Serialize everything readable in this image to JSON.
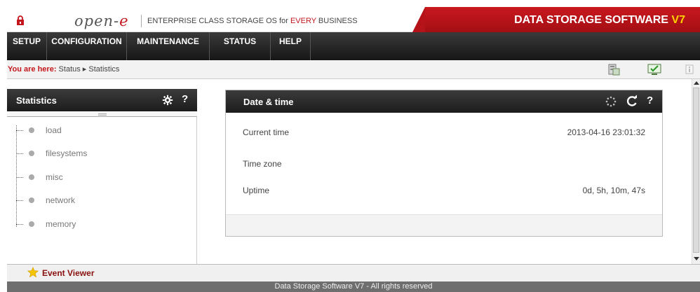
{
  "header": {
    "logo_text": "open-",
    "logo_e": "e",
    "tagline_prefix": "ENTERPRISE CLASS STORAGE OS for ",
    "tagline_highlight": "EVERY",
    "tagline_suffix": " BUSINESS",
    "product_name": "DATA STORAGE SOFTWARE ",
    "product_version": "V7",
    "lock_icon": "lock-icon",
    "brand_color": "#c4161c"
  },
  "menu": {
    "items": [
      {
        "label": "SETUP"
      },
      {
        "label": "CONFIGURATION"
      },
      {
        "label": "MAINTENANCE"
      },
      {
        "label": "STATUS"
      },
      {
        "label": "HELP"
      }
    ]
  },
  "breadcrumb": {
    "label": "You are here:",
    "path": [
      " Status ",
      " Statistics"
    ]
  },
  "toolbar": {
    "icons": [
      "server-icon",
      "monitor-check-icon",
      "info-icon"
    ]
  },
  "statistics_panel": {
    "title": "Statistics",
    "help": "?",
    "tree": [
      "load",
      "filesystems",
      "misc",
      "network",
      "memory"
    ]
  },
  "datetime_panel": {
    "title": "Date & time",
    "help": "?",
    "rows": [
      {
        "label": "Current time",
        "value": "2013-04-16 23:01:32"
      },
      {
        "label": "Time zone",
        "value": ""
      },
      {
        "label": "Uptime",
        "value": "0d, 5h, 10m, 47s"
      }
    ]
  },
  "bottom": {
    "event_viewer": "Event Viewer"
  },
  "footer": {
    "text": "Data Storage Software V7 - All rights reserved"
  }
}
